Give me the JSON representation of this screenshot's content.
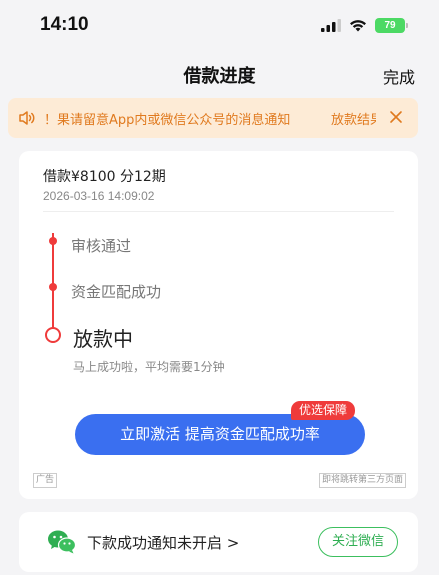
{
  "status": {
    "time": "14:10",
    "battery": "79"
  },
  "nav": {
    "title": "借款进度",
    "done": "完成"
  },
  "notice": {
    "text": "！果请留意App内或微信公众号的消息通知",
    "text_cont": "放款结果"
  },
  "loan": {
    "summary": "借款¥8100  分12期",
    "date": "2026-03-16 14:09:02"
  },
  "steps": [
    {
      "label": "审核通过"
    },
    {
      "label": "资金匹配成功"
    }
  ],
  "current_step": {
    "label": "放款中",
    "desc": "马上成功啦，平均需要1分钟"
  },
  "promo": {
    "badge": "优选保障",
    "button": "立即激活 提高资金匹配成功率"
  },
  "ad": {
    "mark": "广告",
    "redirect": "即将跳转第三方页面"
  },
  "wechat": {
    "text": "下款成功通知未开启 >",
    "follow": "关注微信"
  },
  "colors": {
    "accent_red": "#ef3b3b",
    "primary_blue": "#3a6ff0",
    "wechat_green": "#3cbf5e",
    "notice_orange": "#e07a1f"
  }
}
